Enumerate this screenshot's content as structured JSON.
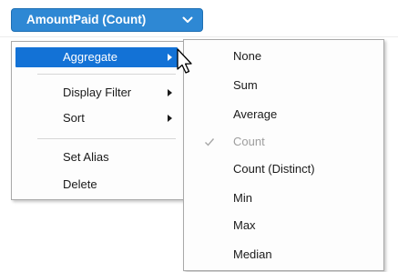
{
  "field_pill": {
    "label": "AmountPaid (Count)",
    "icon": "chevron-down-icon"
  },
  "context_menu": {
    "items": [
      {
        "label": "Aggregate",
        "has_submenu": true,
        "highlighted": true
      },
      {
        "label": "Display Filter",
        "has_submenu": true
      },
      {
        "label": "Sort",
        "has_submenu": true
      },
      {
        "label": "Set Alias"
      },
      {
        "label": "Delete"
      }
    ]
  },
  "aggregate_submenu": {
    "items": [
      {
        "label": "None"
      },
      {
        "label": "Sum"
      },
      {
        "label": "Average"
      },
      {
        "label": "Count",
        "checked": true,
        "disabled": true
      },
      {
        "label": "Count (Distinct)"
      },
      {
        "label": "Min"
      },
      {
        "label": "Max"
      },
      {
        "label": "Median"
      }
    ]
  },
  "colors": {
    "pill_background": "#2e88d4",
    "highlight": "#1372d6",
    "disabled_text": "#9e9e9e"
  },
  "icons": {
    "submenu_arrow": "triangle-right-icon",
    "checkmark": "check-icon",
    "pointer": "mouse-pointer-icon"
  }
}
